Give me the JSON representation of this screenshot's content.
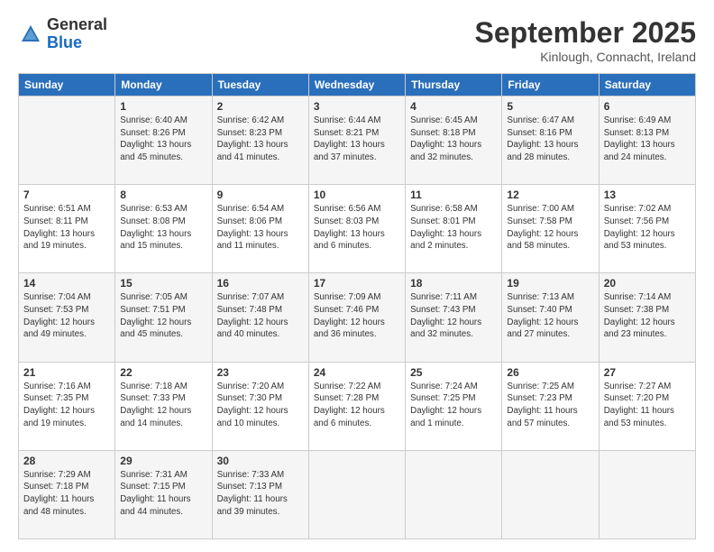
{
  "logo": {
    "general": "General",
    "blue": "Blue"
  },
  "title": "September 2025",
  "subtitle": "Kinlough, Connacht, Ireland",
  "days_of_week": [
    "Sunday",
    "Monday",
    "Tuesday",
    "Wednesday",
    "Thursday",
    "Friday",
    "Saturday"
  ],
  "weeks": [
    [
      {
        "day": "",
        "info": ""
      },
      {
        "day": "1",
        "info": "Sunrise: 6:40 AM\nSunset: 8:26 PM\nDaylight: 13 hours\nand 45 minutes."
      },
      {
        "day": "2",
        "info": "Sunrise: 6:42 AM\nSunset: 8:23 PM\nDaylight: 13 hours\nand 41 minutes."
      },
      {
        "day": "3",
        "info": "Sunrise: 6:44 AM\nSunset: 8:21 PM\nDaylight: 13 hours\nand 37 minutes."
      },
      {
        "day": "4",
        "info": "Sunrise: 6:45 AM\nSunset: 8:18 PM\nDaylight: 13 hours\nand 32 minutes."
      },
      {
        "day": "5",
        "info": "Sunrise: 6:47 AM\nSunset: 8:16 PM\nDaylight: 13 hours\nand 28 minutes."
      },
      {
        "day": "6",
        "info": "Sunrise: 6:49 AM\nSunset: 8:13 PM\nDaylight: 13 hours\nand 24 minutes."
      }
    ],
    [
      {
        "day": "7",
        "info": "Sunrise: 6:51 AM\nSunset: 8:11 PM\nDaylight: 13 hours\nand 19 minutes."
      },
      {
        "day": "8",
        "info": "Sunrise: 6:53 AM\nSunset: 8:08 PM\nDaylight: 13 hours\nand 15 minutes."
      },
      {
        "day": "9",
        "info": "Sunrise: 6:54 AM\nSunset: 8:06 PM\nDaylight: 13 hours\nand 11 minutes."
      },
      {
        "day": "10",
        "info": "Sunrise: 6:56 AM\nSunset: 8:03 PM\nDaylight: 13 hours\nand 6 minutes."
      },
      {
        "day": "11",
        "info": "Sunrise: 6:58 AM\nSunset: 8:01 PM\nDaylight: 13 hours\nand 2 minutes."
      },
      {
        "day": "12",
        "info": "Sunrise: 7:00 AM\nSunset: 7:58 PM\nDaylight: 12 hours\nand 58 minutes."
      },
      {
        "day": "13",
        "info": "Sunrise: 7:02 AM\nSunset: 7:56 PM\nDaylight: 12 hours\nand 53 minutes."
      }
    ],
    [
      {
        "day": "14",
        "info": "Sunrise: 7:04 AM\nSunset: 7:53 PM\nDaylight: 12 hours\nand 49 minutes."
      },
      {
        "day": "15",
        "info": "Sunrise: 7:05 AM\nSunset: 7:51 PM\nDaylight: 12 hours\nand 45 minutes."
      },
      {
        "day": "16",
        "info": "Sunrise: 7:07 AM\nSunset: 7:48 PM\nDaylight: 12 hours\nand 40 minutes."
      },
      {
        "day": "17",
        "info": "Sunrise: 7:09 AM\nSunset: 7:46 PM\nDaylight: 12 hours\nand 36 minutes."
      },
      {
        "day": "18",
        "info": "Sunrise: 7:11 AM\nSunset: 7:43 PM\nDaylight: 12 hours\nand 32 minutes."
      },
      {
        "day": "19",
        "info": "Sunrise: 7:13 AM\nSunset: 7:40 PM\nDaylight: 12 hours\nand 27 minutes."
      },
      {
        "day": "20",
        "info": "Sunrise: 7:14 AM\nSunset: 7:38 PM\nDaylight: 12 hours\nand 23 minutes."
      }
    ],
    [
      {
        "day": "21",
        "info": "Sunrise: 7:16 AM\nSunset: 7:35 PM\nDaylight: 12 hours\nand 19 minutes."
      },
      {
        "day": "22",
        "info": "Sunrise: 7:18 AM\nSunset: 7:33 PM\nDaylight: 12 hours\nand 14 minutes."
      },
      {
        "day": "23",
        "info": "Sunrise: 7:20 AM\nSunset: 7:30 PM\nDaylight: 12 hours\nand 10 minutes."
      },
      {
        "day": "24",
        "info": "Sunrise: 7:22 AM\nSunset: 7:28 PM\nDaylight: 12 hours\nand 6 minutes."
      },
      {
        "day": "25",
        "info": "Sunrise: 7:24 AM\nSunset: 7:25 PM\nDaylight: 12 hours\nand 1 minute."
      },
      {
        "day": "26",
        "info": "Sunrise: 7:25 AM\nSunset: 7:23 PM\nDaylight: 11 hours\nand 57 minutes."
      },
      {
        "day": "27",
        "info": "Sunrise: 7:27 AM\nSunset: 7:20 PM\nDaylight: 11 hours\nand 53 minutes."
      }
    ],
    [
      {
        "day": "28",
        "info": "Sunrise: 7:29 AM\nSunset: 7:18 PM\nDaylight: 11 hours\nand 48 minutes."
      },
      {
        "day": "29",
        "info": "Sunrise: 7:31 AM\nSunset: 7:15 PM\nDaylight: 11 hours\nand 44 minutes."
      },
      {
        "day": "30",
        "info": "Sunrise: 7:33 AM\nSunset: 7:13 PM\nDaylight: 11 hours\nand 39 minutes."
      },
      {
        "day": "",
        "info": ""
      },
      {
        "day": "",
        "info": ""
      },
      {
        "day": "",
        "info": ""
      },
      {
        "day": "",
        "info": ""
      }
    ]
  ]
}
